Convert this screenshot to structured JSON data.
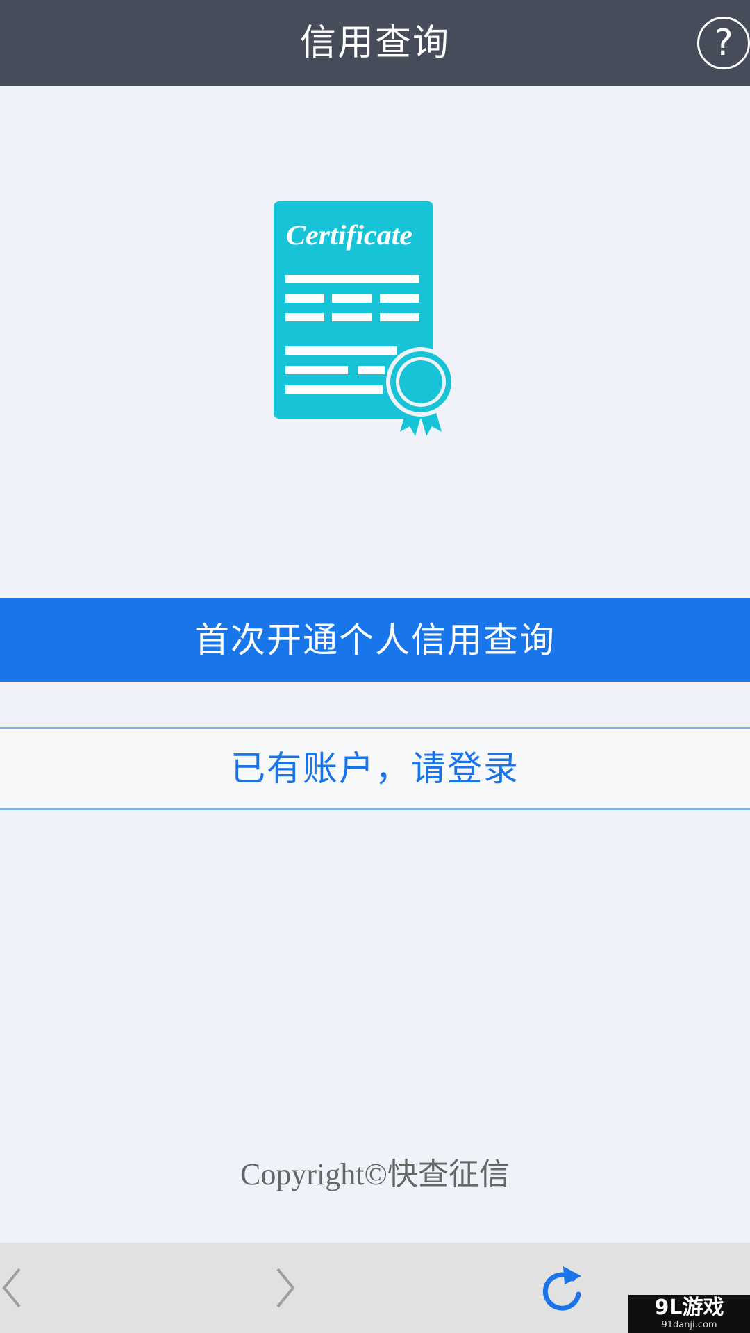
{
  "header": {
    "title": "信用查询",
    "help_icon": "question-circle-icon",
    "help_glyph": "?",
    "background": "#474c5a"
  },
  "illustration": {
    "icon": "certificate-icon",
    "script_text": "Certificate",
    "color": "#17c3d6"
  },
  "actions": {
    "primary_label": "首次开通个人信用查询",
    "secondary_label": "已有账户，请登录",
    "primary_color": "#1976ea",
    "secondary_text_color": "#1a73e8"
  },
  "footer": {
    "copyright": "Copyright©快查征信"
  },
  "browser_bar": {
    "back_icon": "chevron-left-icon",
    "forward_icon": "chevron-right-icon",
    "refresh_icon": "refresh-icon"
  },
  "watermark": {
    "main": "9L游戏",
    "sub": "91danji.com"
  }
}
